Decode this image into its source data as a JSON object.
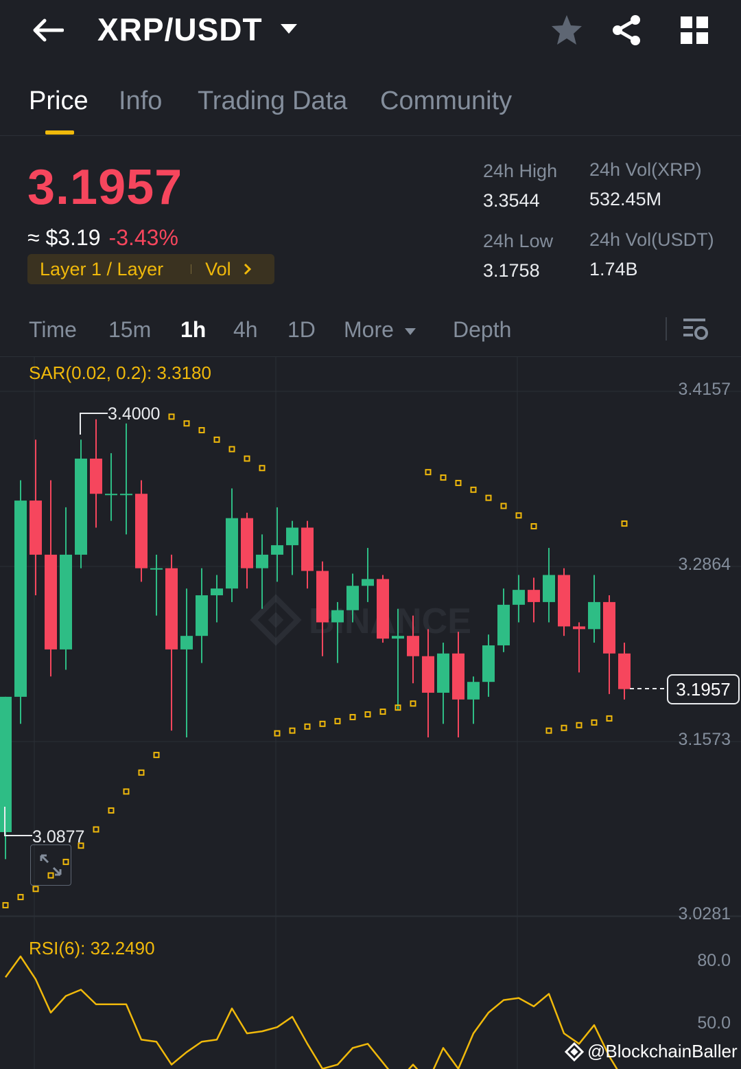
{
  "header": {
    "pair": "XRP/USDT"
  },
  "tabs": [
    "Price",
    "Info",
    "Trading Data",
    "Community"
  ],
  "price": {
    "last": "3.1957",
    "usd": "≈ $3.19",
    "change": "-3.43%",
    "tag": "Layer 1 / Layer",
    "tag_vol": "Vol"
  },
  "stats": {
    "high_label": "24h High",
    "high": "3.3544",
    "low_label": "24h Low",
    "low": "3.1758",
    "vol_base_label": "24h Vol(XRP)",
    "vol_base": "532.45M",
    "vol_quote_label": "24h Vol(USDT)",
    "vol_quote": "1.74B"
  },
  "intervals": [
    "Time",
    "15m",
    "1h",
    "4h",
    "1D",
    "More",
    "Depth"
  ],
  "chart": {
    "sar_label": "SAR(0.02, 0.2): 3.3180",
    "rsi_label": "RSI(6): 32.2490",
    "current_price": "3.1957",
    "high_marker": "3.4000",
    "low_marker": "3.0877",
    "watermark": "@BlockchainBaller",
    "colors": {
      "up": "#2ebd85",
      "down": "#f6465d",
      "indicator": "#f0b90b"
    }
  },
  "chart_data": {
    "type": "candlestick",
    "interval": "1h",
    "y_ticks": [
      "3.4157",
      "3.2864",
      "3.1573",
      "3.0281"
    ],
    "rsi_ticks": [
      "80.0",
      "50.0"
    ],
    "candles": [
      {
        "o": 3.09,
        "h": 3.19,
        "l": 3.07,
        "c": 3.19
      },
      {
        "o": 3.19,
        "h": 3.35,
        "l": 3.17,
        "c": 3.335
      },
      {
        "o": 3.335,
        "h": 3.38,
        "l": 3.265,
        "c": 3.295
      },
      {
        "o": 3.295,
        "h": 3.35,
        "l": 3.205,
        "c": 3.225
      },
      {
        "o": 3.225,
        "h": 3.33,
        "l": 3.21,
        "c": 3.295
      },
      {
        "o": 3.295,
        "h": 3.38,
        "l": 3.285,
        "c": 3.366
      },
      {
        "o": 3.366,
        "h": 3.395,
        "l": 3.315,
        "c": 3.34
      },
      {
        "o": 3.34,
        "h": 3.37,
        "l": 3.32,
        "c": 3.34
      },
      {
        "o": 3.34,
        "h": 3.392,
        "l": 3.31,
        "c": 3.34
      },
      {
        "o": 3.34,
        "h": 3.35,
        "l": 3.275,
        "c": 3.285
      },
      {
        "o": 3.285,
        "h": 3.295,
        "l": 3.25,
        "c": 3.285
      },
      {
        "o": 3.285,
        "h": 3.295,
        "l": 3.165,
        "c": 3.225
      },
      {
        "o": 3.225,
        "h": 3.27,
        "l": 3.16,
        "c": 3.235
      },
      {
        "o": 3.235,
        "h": 3.285,
        "l": 3.215,
        "c": 3.265
      },
      {
        "o": 3.265,
        "h": 3.28,
        "l": 3.245,
        "c": 3.27
      },
      {
        "o": 3.27,
        "h": 3.344,
        "l": 3.26,
        "c": 3.322
      },
      {
        "o": 3.322,
        "h": 3.326,
        "l": 3.27,
        "c": 3.285
      },
      {
        "o": 3.285,
        "h": 3.31,
        "l": 3.255,
        "c": 3.295
      },
      {
        "o": 3.295,
        "h": 3.33,
        "l": 3.275,
        "c": 3.302
      },
      {
        "o": 3.302,
        "h": 3.32,
        "l": 3.28,
        "c": 3.315
      },
      {
        "o": 3.315,
        "h": 3.32,
        "l": 3.27,
        "c": 3.283
      },
      {
        "o": 3.283,
        "h": 3.29,
        "l": 3.22,
        "c": 3.245
      },
      {
        "o": 3.245,
        "h": 3.26,
        "l": 3.215,
        "c": 3.254
      },
      {
        "o": 3.254,
        "h": 3.281,
        "l": 3.245,
        "c": 3.272
      },
      {
        "o": 3.272,
        "h": 3.3,
        "l": 3.26,
        "c": 3.277
      },
      {
        "o": 3.277,
        "h": 3.28,
        "l": 3.23,
        "c": 3.233
      },
      {
        "o": 3.233,
        "h": 3.255,
        "l": 3.18,
        "c": 3.235
      },
      {
        "o": 3.235,
        "h": 3.25,
        "l": 3.2,
        "c": 3.22
      },
      {
        "o": 3.22,
        "h": 3.24,
        "l": 3.16,
        "c": 3.193
      },
      {
        "o": 3.193,
        "h": 3.23,
        "l": 3.17,
        "c": 3.222
      },
      {
        "o": 3.222,
        "h": 3.238,
        "l": 3.16,
        "c": 3.188
      },
      {
        "o": 3.188,
        "h": 3.205,
        "l": 3.17,
        "c": 3.201
      },
      {
        "o": 3.201,
        "h": 3.236,
        "l": 3.19,
        "c": 3.228
      },
      {
        "o": 3.228,
        "h": 3.27,
        "l": 3.223,
        "c": 3.258
      },
      {
        "o": 3.258,
        "h": 3.28,
        "l": 3.245,
        "c": 3.269
      },
      {
        "o": 3.269,
        "h": 3.278,
        "l": 3.245,
        "c": 3.26
      },
      {
        "o": 3.26,
        "h": 3.3,
        "l": 3.245,
        "c": 3.28
      },
      {
        "o": 3.28,
        "h": 3.285,
        "l": 3.235,
        "c": 3.242
      },
      {
        "o": 3.242,
        "h": 3.245,
        "l": 3.208,
        "c": 3.24
      },
      {
        "o": 3.24,
        "h": 3.28,
        "l": 3.23,
        "c": 3.26
      },
      {
        "o": 3.26,
        "h": 3.265,
        "l": 3.192,
        "c": 3.222
      },
      {
        "o": 3.222,
        "h": 3.23,
        "l": 3.188,
        "c": 3.1957
      }
    ],
    "sar_points": [
      3.036,
      3.042,
      3.048,
      3.058,
      3.068,
      3.08,
      3.092,
      3.106,
      3.12,
      3.134,
      3.147,
      3.397,
      3.392,
      3.387,
      3.38,
      3.373,
      3.366,
      3.359,
      3.163,
      3.165,
      3.168,
      3.17,
      3.172,
      3.175,
      3.177,
      3.179,
      3.182,
      3.185,
      3.356,
      3.352,
      3.348,
      3.343,
      3.337,
      3.331,
      3.324,
      3.316,
      3.165,
      3.167,
      3.169,
      3.171,
      3.174,
      3.318
    ],
    "rsi": [
      72,
      82,
      71,
      55,
      63,
      66,
      59,
      59,
      59,
      42,
      41,
      30,
      36,
      41,
      42,
      57,
      45,
      46,
      48,
      53,
      40,
      28,
      30,
      38,
      40,
      31,
      22,
      30,
      22,
      38,
      28,
      45,
      55,
      61,
      62,
      58,
      64,
      45,
      40,
      49,
      34,
      22
    ]
  }
}
